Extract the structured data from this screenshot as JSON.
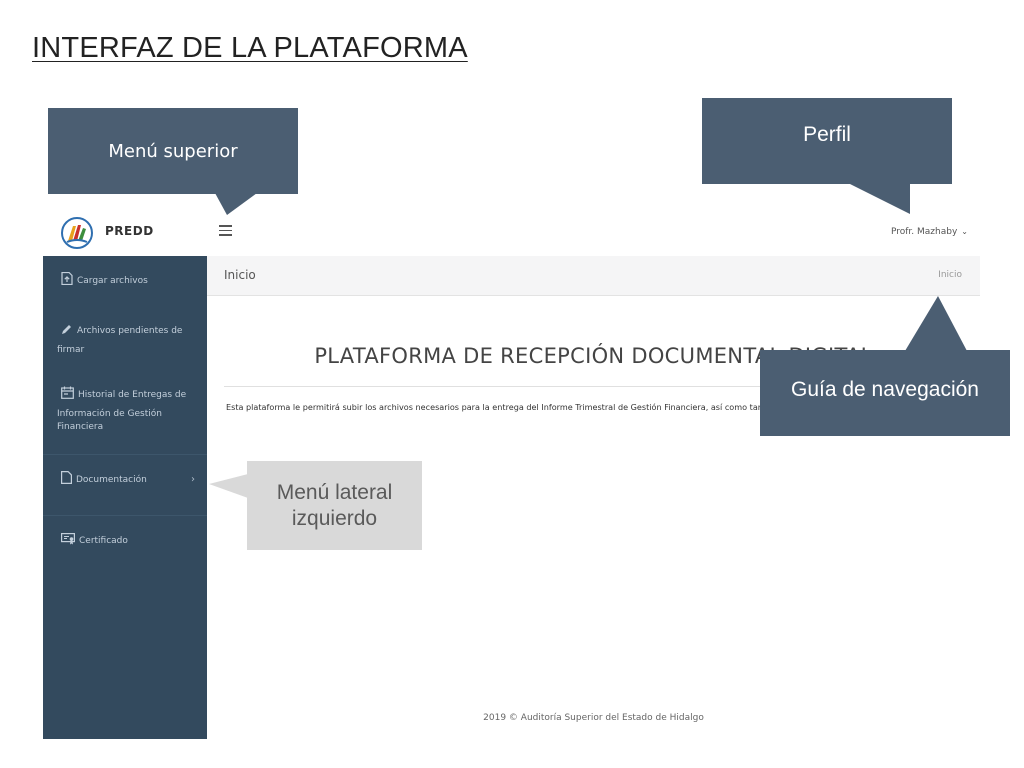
{
  "slide_title": "INTERFAZ DE LA PLATAFORMA",
  "callouts": {
    "menu_superior": "Menú superior",
    "perfil": "Perfil",
    "guia": "Guía de navegación",
    "lateral_line1": "Menú lateral",
    "lateral_line2": "izquierdo"
  },
  "app": {
    "brand": "PREDD",
    "profile_name": "Profr. Mazhaby",
    "sidebar": [
      {
        "label": "Cargar archivos",
        "icon": "upload-file-icon"
      },
      {
        "label_line1": "Archivos pendientes de",
        "label_line2": "firmar",
        "icon": "pencil-icon"
      },
      {
        "label_line1": "Historial de Entregas de",
        "label_line2": "Información de Gestión",
        "label_line3": "Financiera",
        "icon": "calendar-icon"
      },
      {
        "label": "Documentación",
        "icon": "document-icon",
        "arrow": "›"
      },
      {
        "label": "Certificado",
        "icon": "certificate-icon"
      }
    ],
    "breadcrumb_title": "Inicio",
    "breadcrumb_link": "Inicio",
    "heading": "PLATAFORMA DE RECEPCIÓN DOCUMENTAL DIGITAL",
    "description": "Esta plataforma le permitirá subir los archivos necesarios para la entrega del Informe Trimestral de Gestión Financiera, así como también firmarlo de una forma rápida y sencilla.",
    "footer": "2019 © Auditoría Superior del Estado de Hidalgo"
  },
  "colors": {
    "sidebar": "#334a5e",
    "callout_dark": "#4b5e72",
    "callout_light": "#d9d9d9"
  }
}
